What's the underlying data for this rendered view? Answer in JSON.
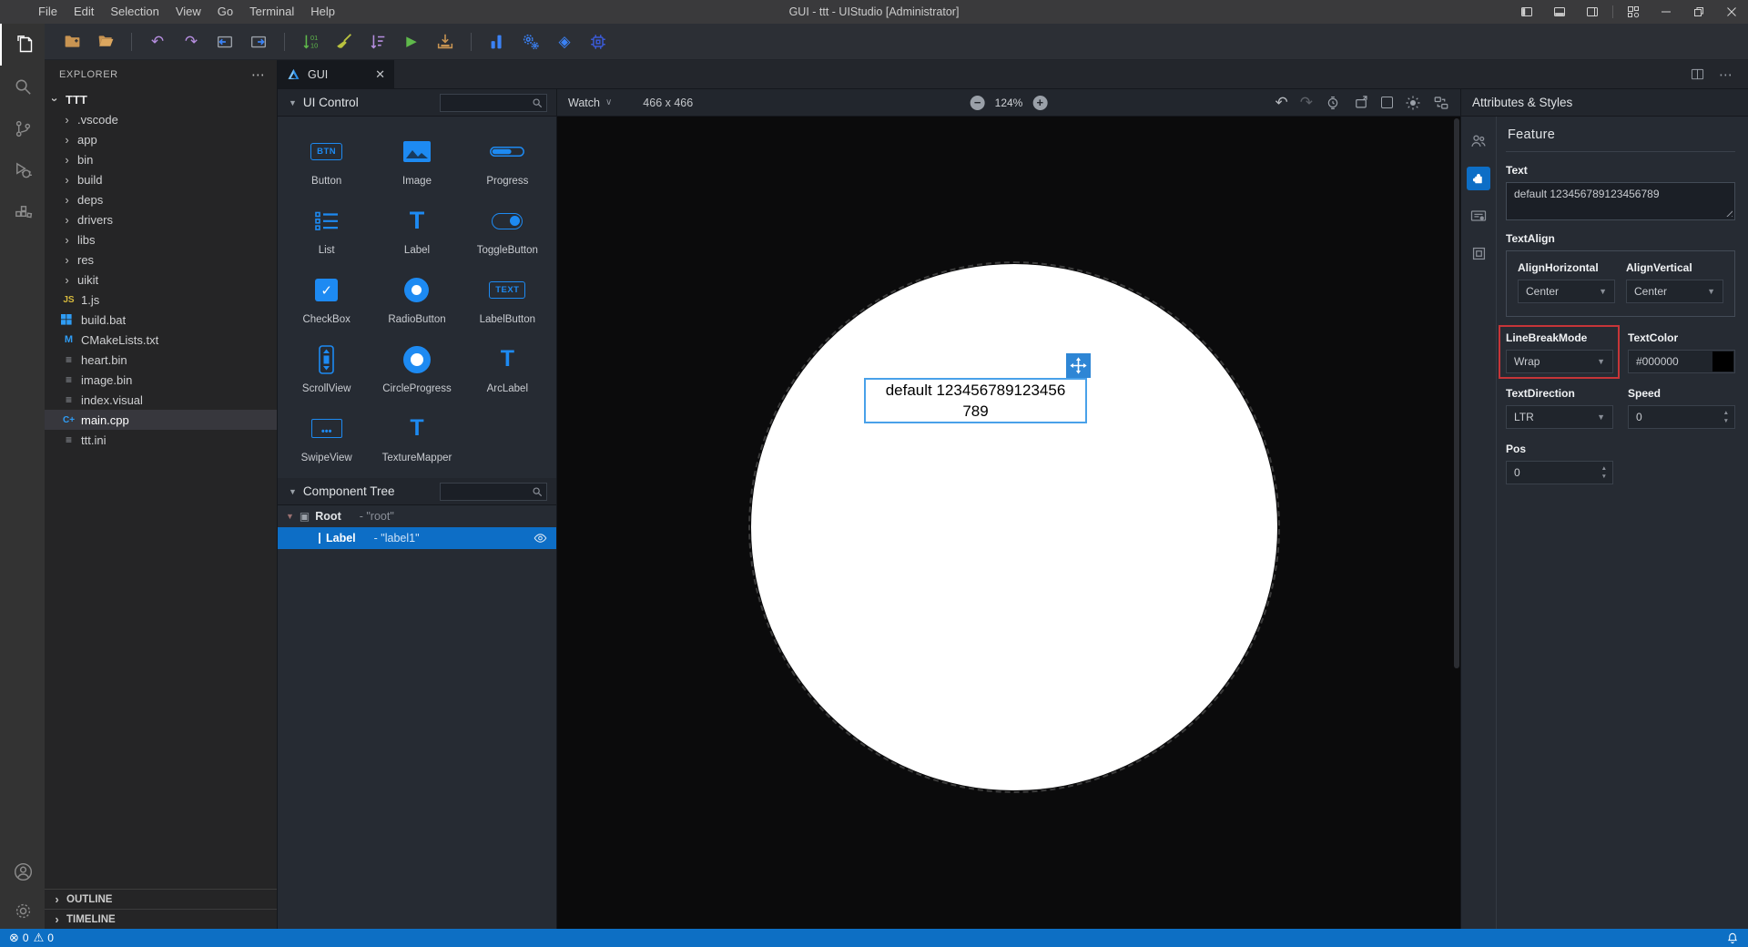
{
  "window": {
    "menu": [
      "File",
      "Edit",
      "Selection",
      "View",
      "Go",
      "Terminal",
      "Help"
    ],
    "title": "GUI - ttt - UIStudio [Administrator]"
  },
  "explorer": {
    "header": "EXPLORER",
    "root": "TTT",
    "folders": [
      ".vscode",
      "app",
      "bin",
      "build",
      "deps",
      "drivers",
      "libs",
      "res",
      "uikit"
    ],
    "files": [
      {
        "name": "1.js",
        "icon": "js"
      },
      {
        "name": "build.bat",
        "icon": "windows"
      },
      {
        "name": "CMakeLists.txt",
        "icon": "cmake"
      },
      {
        "name": "heart.bin",
        "icon": "file-lines"
      },
      {
        "name": "image.bin",
        "icon": "file-lines"
      },
      {
        "name": "index.visual",
        "icon": "file-lines"
      },
      {
        "name": "main.cpp",
        "icon": "cpp"
      },
      {
        "name": "ttt.ini",
        "icon": "file-lines"
      }
    ],
    "sections": [
      "OUTLINE",
      "TIMELINE"
    ]
  },
  "tab": {
    "label": "GUI"
  },
  "ui_control": {
    "title": "UI Control",
    "button_badge": "BTN",
    "labelbutton_badge": "TEXT",
    "items": [
      "Button",
      "Image",
      "Progress",
      "List",
      "Label",
      "ToggleButton",
      "CheckBox",
      "RadioButton",
      "LabelButton",
      "ScrollView",
      "CircleProgress",
      "ArcLabel",
      "SwipeView",
      "TextureMapper"
    ]
  },
  "component_tree": {
    "title": "Component Tree",
    "root_type": "Root",
    "root_name": "- \"root\"",
    "child_type": "Label",
    "child_name": "- \"label1\""
  },
  "canvas": {
    "watch": "Watch",
    "size": "466 x 466",
    "zoom": "124%",
    "label_full": "default 123456789123456789",
    "label_line1": "default 123456789123456",
    "label_line2": "789"
  },
  "attributes": {
    "panel_title": "Attributes & Styles",
    "section": "Feature",
    "text_label": "Text",
    "text_value": "default 123456789123456789",
    "textalign_label": "TextAlign",
    "align_h_label": "AlignHorizontal",
    "align_h_value": "Center",
    "align_v_label": "AlignVertical",
    "align_v_value": "Center",
    "linebreak_label": "LineBreakMode",
    "linebreak_value": "Wrap",
    "textcolor_label": "TextColor",
    "textcolor_value": "#000000",
    "textdir_label": "TextDirection",
    "textdir_value": "LTR",
    "speed_label": "Speed",
    "speed_value": "0",
    "pos_label": "Pos",
    "pos_value": "0"
  },
  "statusbar": {
    "errors": "0",
    "warnings": "0"
  },
  "colors": {
    "accent": "#1d8af2",
    "tree_selection": "#0d6ec6",
    "statusbar": "#0d6fc4",
    "highlight_red": "#c63538",
    "canvas_label_border": "#49a1e9",
    "textcolor_swatch": "#000000"
  }
}
